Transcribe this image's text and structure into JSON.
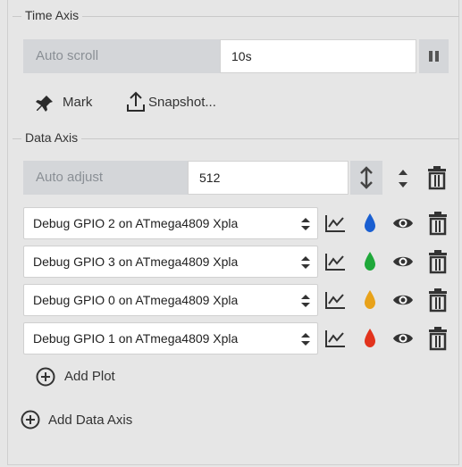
{
  "time_axis": {
    "title": "Time Axis",
    "auto_scroll_label": "Auto scroll",
    "time_value": "10s",
    "mark_label": "Mark",
    "snapshot_label": "Snapshot..."
  },
  "data_axis": {
    "title": "Data Axis",
    "auto_adjust_label": "Auto adjust",
    "range_value": "512",
    "plots": [
      {
        "label": "Debug GPIO 2 on ATmega4809 Xpla",
        "color": "#1a5fd1"
      },
      {
        "label": "Debug GPIO 3 on ATmega4809 Xpla",
        "color": "#1fa83a"
      },
      {
        "label": "Debug GPIO 0 on ATmega4809 Xpla",
        "color": "#e8a21a"
      },
      {
        "label": "Debug GPIO 1 on ATmega4809 Xpla",
        "color": "#e2331d"
      }
    ],
    "add_plot_label": "Add Plot"
  },
  "add_data_axis_label": "Add Data Axis"
}
